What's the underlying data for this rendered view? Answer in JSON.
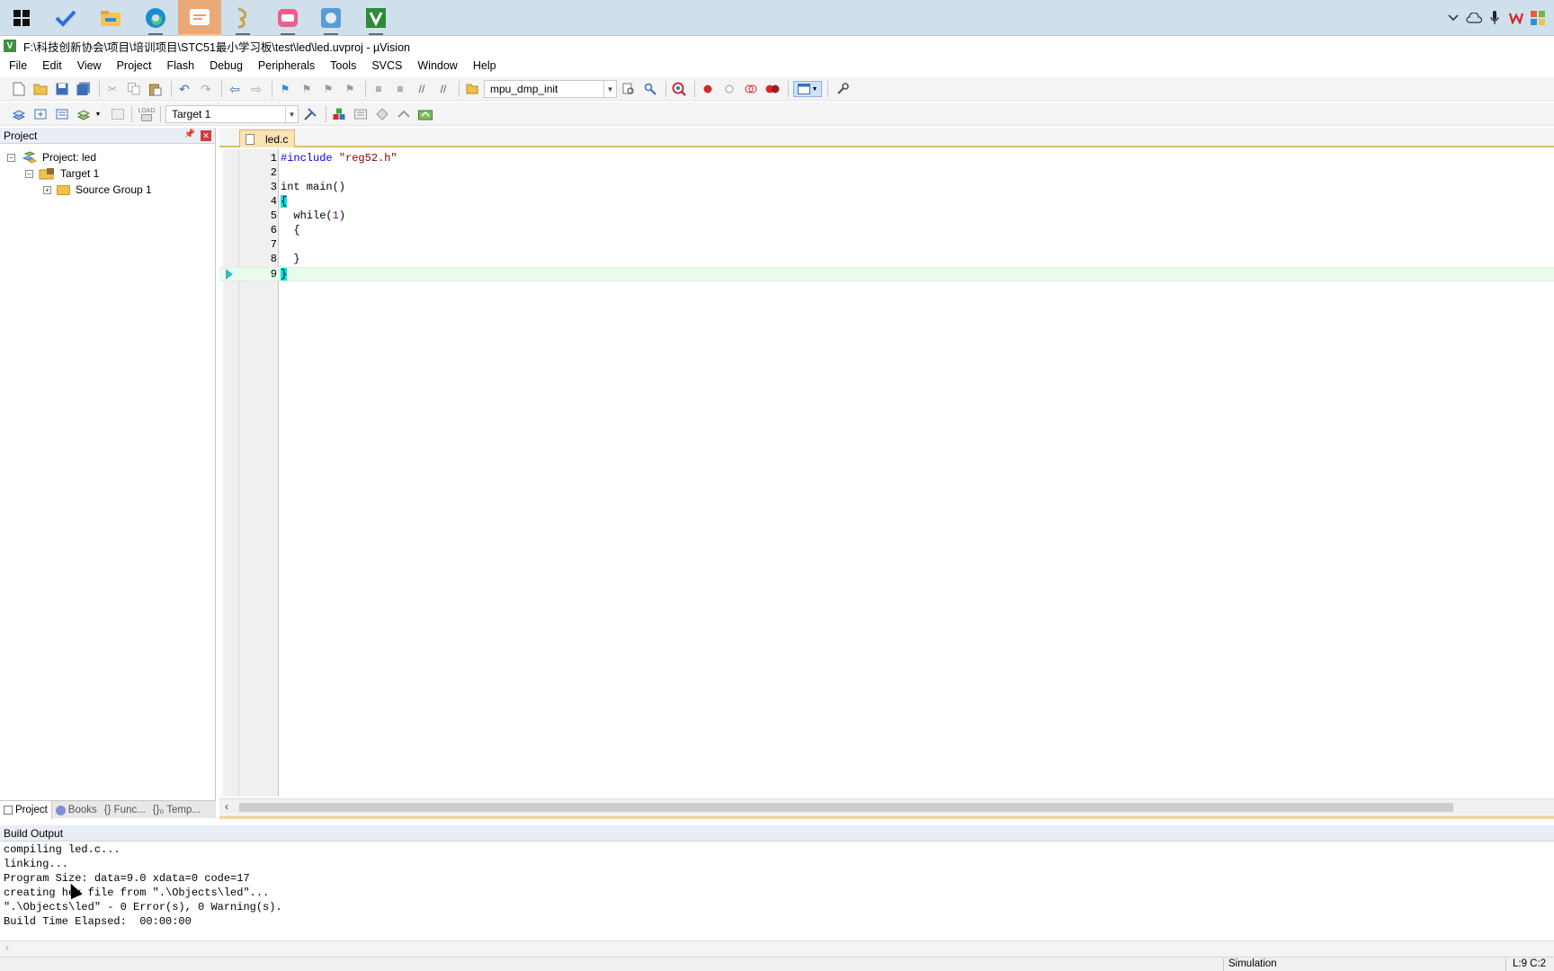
{
  "window": {
    "title": "F:\\科技创新协会\\项目\\培训项目\\STC51最小学习板\\test\\led\\led.uvproj - µVision"
  },
  "taskbar": {
    "apps": [
      "windows-start",
      "todo",
      "file-explorer",
      "edge",
      "feishu-doc",
      "keil-green-dragon",
      "bilibili",
      "snipping-tool",
      "keil-uvision"
    ]
  },
  "menu": [
    "File",
    "Edit",
    "View",
    "Project",
    "Flash",
    "Debug",
    "Peripherals",
    "Tools",
    "SVCS",
    "Window",
    "Help"
  ],
  "toolbar": {
    "find_combo_value": "mpu_dmp_init",
    "target_combo_value": "Target 1",
    "load_label": "LOAD"
  },
  "project_pane": {
    "header": "Project",
    "tree": [
      {
        "label": "Project: led",
        "expander": "−"
      },
      {
        "label": "Target 1",
        "expander": "−"
      },
      {
        "label": "Source Group 1",
        "expander": "+"
      }
    ],
    "tabs": [
      "Project",
      "Books",
      "{} Func...",
      "{}₀ Temp..."
    ]
  },
  "editor": {
    "tab": "led.c",
    "lines": [
      {
        "n": "1",
        "text": "#include \"reg52.h\""
      },
      {
        "n": "2",
        "text": ""
      },
      {
        "n": "3",
        "text": "int main()"
      },
      {
        "n": "4",
        "text": "{"
      },
      {
        "n": "5",
        "text": "  while(1)"
      },
      {
        "n": "6",
        "text": "  {"
      },
      {
        "n": "7",
        "text": ""
      },
      {
        "n": "8",
        "text": "  }"
      },
      {
        "n": "9",
        "text": "}"
      }
    ],
    "current_line": 9
  },
  "build_output": {
    "header": "Build Output",
    "lines": [
      "compiling led.c...",
      "linking...",
      "Program Size: data=9.0 xdata=0 code=17",
      "creating hex file from \".\\Objects\\led\"...",
      "\".\\Objects\\led\" - 0 Error(s), 0 Warning(s).",
      "Build Time Elapsed:  00:00:00"
    ]
  },
  "status": {
    "mode": "Simulation",
    "position": "L:9 C:2"
  },
  "colors": {
    "taskbar": "#cfe0ec",
    "tab_active": "#fbe3b3",
    "current_line": "#e9fbeb",
    "brace_highlight": "#00e0e0"
  }
}
